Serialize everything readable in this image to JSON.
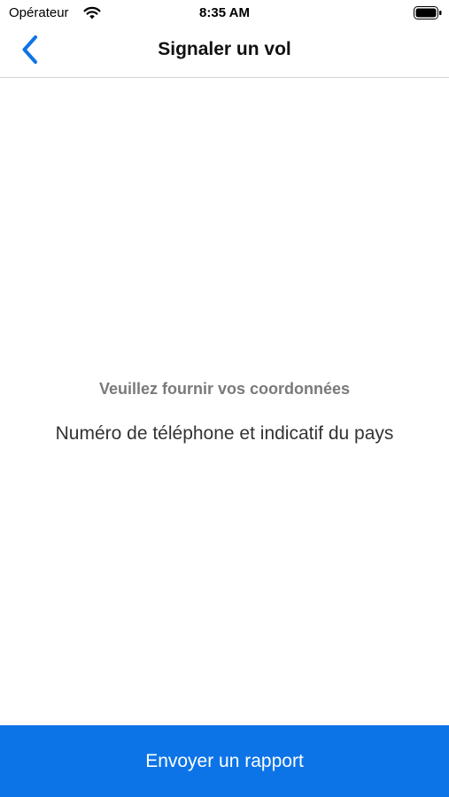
{
  "status_bar": {
    "carrier": "Opérateur",
    "time": "8:35 AM",
    "icons": [
      "wifi-icon",
      "battery-icon"
    ]
  },
  "nav": {
    "title": "Signaler un vol",
    "back_icon": "chevron-left-icon",
    "accent_color": "#0d74e7"
  },
  "content": {
    "prompt": "Veuillez fournir vos coordonnées",
    "phone_field_placeholder": "Numéro de téléphone et indicatif du pays"
  },
  "footer": {
    "submit_label": "Envoyer un rapport",
    "button_color": "#0d74e7"
  }
}
